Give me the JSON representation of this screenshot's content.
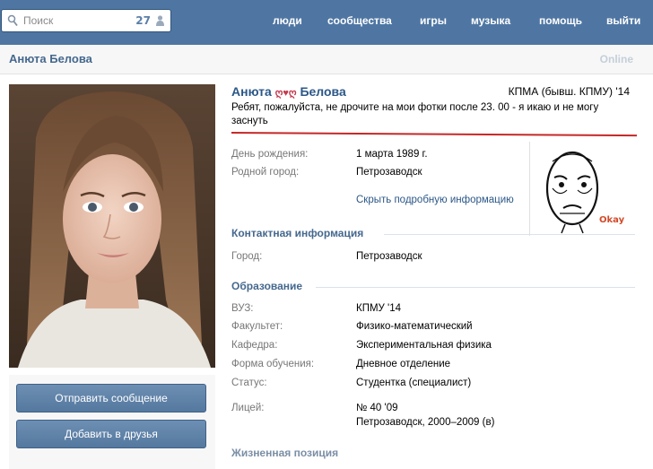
{
  "topbar": {
    "search_placeholder": "Поиск",
    "counter": "27",
    "nav": [
      "люди",
      "сообщества",
      "игры",
      "музыка",
      "помощь",
      "выйти"
    ]
  },
  "strip": {
    "name": "Анюта Белова",
    "online": "Online"
  },
  "profile": {
    "name_first": "Анюта",
    "name_heart": "ღ♥ღ",
    "name_last": "Белова",
    "university": "КПМА (бывш. КПМУ) '14",
    "status_text": "Ребят, пожалуйста, не дрочите на мои фотки после 23. 00 - я икаю и не могу заснуть",
    "rows": [
      {
        "label": "День рождения:",
        "value": "1 марта 1989 г."
      },
      {
        "label": "Родной город:",
        "value": "Петрозаводск"
      }
    ],
    "hide_link": "Скрыть подробную информацию",
    "contact_header": "Контактная информация",
    "contact_rows": [
      {
        "label": "Город:",
        "value": "Петрозаводск"
      }
    ],
    "education_header": "Образование",
    "education_rows": [
      {
        "label": "ВУЗ:",
        "value": "КПМУ '14"
      },
      {
        "label": "Факультет:",
        "value": "Физико-математический"
      },
      {
        "label": "Кафедра:",
        "value": "Экспериментальная физика"
      },
      {
        "label": "Форма обучения:",
        "value": "Дневное отделение"
      },
      {
        "label": "Статус:",
        "value": "Студентка (специалист)"
      },
      {
        "label": "Лицей:",
        "value": "№ 40 '09"
      }
    ],
    "lyceum_detail": "Петрозаводск, 2000–2009 (в)",
    "cutoff_header": "Жизненная позиция"
  },
  "buttons": {
    "message": "Отправить сообщение",
    "add_friend": "Добавить в друзья"
  },
  "meme": {
    "caption": "Okay"
  },
  "colors": {
    "topbar": "#4f76a3",
    "link": "#45688e",
    "name": "#2b5787",
    "underline": "#c62828"
  }
}
